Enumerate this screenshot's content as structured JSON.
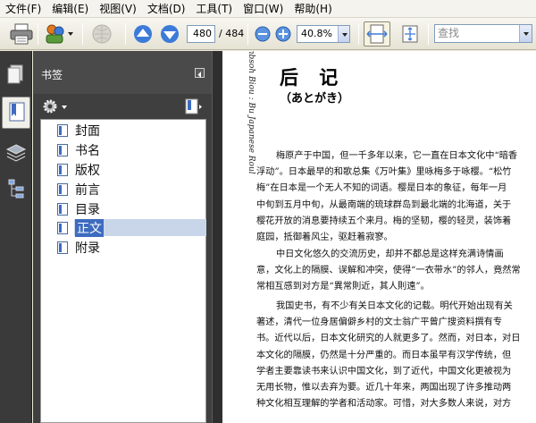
{
  "menu": [
    {
      "label": "文件(F)"
    },
    {
      "label": "编辑(E)"
    },
    {
      "label": "视图(V)"
    },
    {
      "label": "文档(D)"
    },
    {
      "label": "工具(T)"
    },
    {
      "label": "窗口(W)"
    },
    {
      "label": "帮助(H)"
    }
  ],
  "toolbar": {
    "current_page": "480",
    "total_pages": "/ 484",
    "zoom": "40.8%",
    "search_placeholder": "查找"
  },
  "panel": {
    "title": "书签"
  },
  "bookmarks": [
    {
      "label": "封面"
    },
    {
      "label": "书名"
    },
    {
      "label": "版权"
    },
    {
      "label": "前言"
    },
    {
      "label": "目录"
    },
    {
      "label": "正文"
    },
    {
      "label": "附录"
    }
  ],
  "document": {
    "side_text": "mbsoh Biou : Bu Japanese Roul",
    "title": "后 记",
    "subtitle": "（あとがき）",
    "paragraphs": [
      [
        "梅原产于中国，但一千多年以来，它一直在日本文化中“暗香",
        "浮动”。日本最早的和歌总集《万叶集》里咏梅多于咏樱。“松竹",
        "梅”在日本是一个无人不知的词语。樱是日本的象征，每年一月",
        "中旬到五月中旬，从最南端的琉球群岛到最北端的北海道，关于",
        "樱花开放的消息要持续五个来月。梅的坚韧，樱的轻灵，装饰着",
        "庭园，抵御着风尘，驱赶着寂寥。"
      ],
      [
        "中日文化悠久的交流历史，却并不都总是这样充满诗情画",
        "意，文化上的隔膜、误解和冲突，使得“一衣带水”的邻人，竟然常",
        "常相互感到对方是“異常則近，其人則遠”。"
      ],
      [
        "我国史书，有不少有关日本文化的记载。明代开始出现有关",
        "著述，清代一位身居偏僻乡村的文士翁广平曾广搜资料撰有专",
        "书。近代以后，日本文化研究的人就更多了。然而，对日本，对日",
        "本文化的隔膜，仍然是十分严重的。而日本虽早有汉学传统，但",
        "学者主要靠读书来认识中国文化，到了近代，中国文化更被视为",
        "无用长物，惟以去弃为要。近几十年来，两国出现了许多推动两",
        "种文化相互理解的学者和活动家。可惜，对大多数人来说，对方"
      ]
    ]
  },
  "colors": {
    "accent": "#3d6bbf",
    "panel_bg": "#3f3f3f",
    "toolbar_bg": "#ece9d8"
  }
}
